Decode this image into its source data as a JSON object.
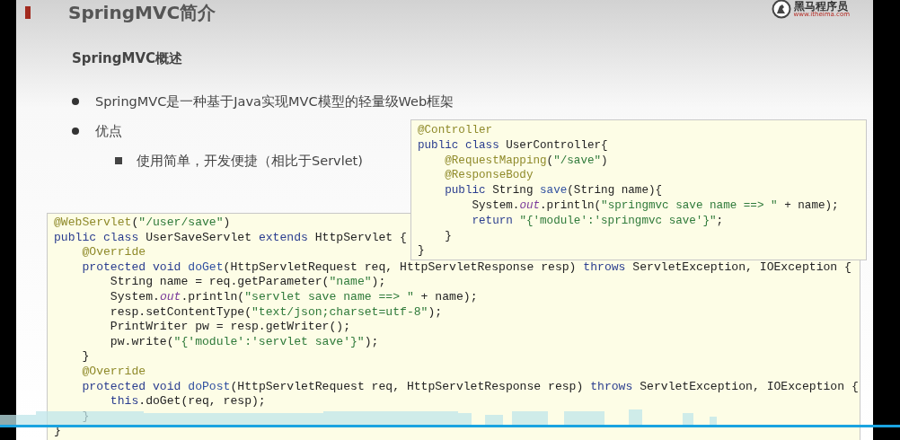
{
  "slide": {
    "title": "SpringMVC简介",
    "logo": {
      "name": "黑马程序员",
      "url": "www.itheima.com"
    },
    "subtitle": "SpringMVC概述",
    "bullets": [
      {
        "text": "SpringMVC是一种基于Java实现MVC模型的轻量级Web框架"
      },
      {
        "text": "优点",
        "children": [
          {
            "text": "使用简单，开发便捷（相比于Servlet)"
          }
        ]
      }
    ],
    "code_blocks": [
      {
        "lines": [
          [
            {
              "kind": "annotation",
              "text": "@WebServlet"
            },
            {
              "kind": "plain",
              "text": "("
            },
            {
              "kind": "string",
              "text": "\"/user/save\""
            },
            {
              "kind": "plain",
              "text": ")"
            }
          ],
          [
            {
              "kind": "keyword",
              "text": "public class "
            },
            {
              "kind": "plain",
              "text": "UserSaveServlet "
            },
            {
              "kind": "keyword",
              "text": "extends "
            },
            {
              "kind": "plain",
              "text": "HttpServlet {"
            }
          ],
          [
            {
              "kind": "annotation",
              "text": "    @Override"
            }
          ],
          [
            {
              "kind": "keyword",
              "text": "    protected void "
            },
            {
              "kind": "method",
              "text": "doGet"
            },
            {
              "kind": "plain",
              "text": "(HttpServletRequest req, HttpServletResponse resp) "
            },
            {
              "kind": "keyword",
              "text": "throws "
            },
            {
              "kind": "plain",
              "text": "ServletException, IOException {"
            }
          ],
          [
            {
              "kind": "plain",
              "text": "        String name = req.getParameter("
            },
            {
              "kind": "string",
              "text": "\"name\""
            },
            {
              "kind": "plain",
              "text": ");"
            }
          ],
          [
            {
              "kind": "plain",
              "text": "        System."
            },
            {
              "kind": "field",
              "text": "out"
            },
            {
              "kind": "plain",
              "text": ".println("
            },
            {
              "kind": "string",
              "text": "\"servlet save name ==> \""
            },
            {
              "kind": "plain",
              "text": " + name);"
            }
          ],
          [
            {
              "kind": "plain",
              "text": "        resp.setContentType("
            },
            {
              "kind": "string",
              "text": "\"text/json;charset=utf-8\""
            },
            {
              "kind": "plain",
              "text": ");"
            }
          ],
          [
            {
              "kind": "plain",
              "text": "        PrintWriter pw = resp.getWriter();"
            }
          ],
          [
            {
              "kind": "plain",
              "text": "        pw.write("
            },
            {
              "kind": "string",
              "text": "\"{'module':'servlet save'}\""
            },
            {
              "kind": "plain",
              "text": ");"
            }
          ],
          [
            {
              "kind": "plain",
              "text": "    }"
            }
          ],
          [
            {
              "kind": "annotation",
              "text": "    @Override"
            }
          ],
          [
            {
              "kind": "keyword",
              "text": "    protected void "
            },
            {
              "kind": "method",
              "text": "doPost"
            },
            {
              "kind": "plain",
              "text": "(HttpServletRequest req, HttpServletResponse resp) "
            },
            {
              "kind": "keyword",
              "text": "throws "
            },
            {
              "kind": "plain",
              "text": "ServletException, IOException {"
            }
          ],
          [
            {
              "kind": "keyword",
              "text": "        this"
            },
            {
              "kind": "plain",
              "text": ".doGet(req, resp);"
            }
          ],
          [
            {
              "kind": "plain",
              "text": "    }"
            }
          ],
          [
            {
              "kind": "plain",
              "text": "}"
            }
          ]
        ]
      },
      {
        "lines": [
          [
            {
              "kind": "annotation",
              "text": "@Controller"
            }
          ],
          [
            {
              "kind": "keyword",
              "text": "public class "
            },
            {
              "kind": "plain",
              "text": "UserController{"
            }
          ],
          [
            {
              "kind": "annotation",
              "text": "    @RequestMapping"
            },
            {
              "kind": "plain",
              "text": "("
            },
            {
              "kind": "string",
              "text": "\"/save\""
            },
            {
              "kind": "plain",
              "text": ")"
            }
          ],
          [
            {
              "kind": "annotation",
              "text": "    @ResponseBody"
            }
          ],
          [
            {
              "kind": "keyword",
              "text": "    public "
            },
            {
              "kind": "plain",
              "text": "String "
            },
            {
              "kind": "method",
              "text": "save"
            },
            {
              "kind": "plain",
              "text": "(String name){"
            }
          ],
          [
            {
              "kind": "plain",
              "text": "        System."
            },
            {
              "kind": "field",
              "text": "out"
            },
            {
              "kind": "plain",
              "text": ".println("
            },
            {
              "kind": "string",
              "text": "\"springmvc save name ==> \""
            },
            {
              "kind": "plain",
              "text": " + name);"
            }
          ],
          [
            {
              "kind": "keyword",
              "text": "        return "
            },
            {
              "kind": "string",
              "text": "\"{'module':'springmvc save'}\""
            },
            {
              "kind": "plain",
              "text": ";"
            }
          ],
          [
            {
              "kind": "plain",
              "text": "    }"
            }
          ],
          [
            {
              "kind": "plain",
              "text": "}"
            }
          ]
        ]
      }
    ]
  },
  "video_player": {
    "progress": {
      "level": 1
    }
  }
}
